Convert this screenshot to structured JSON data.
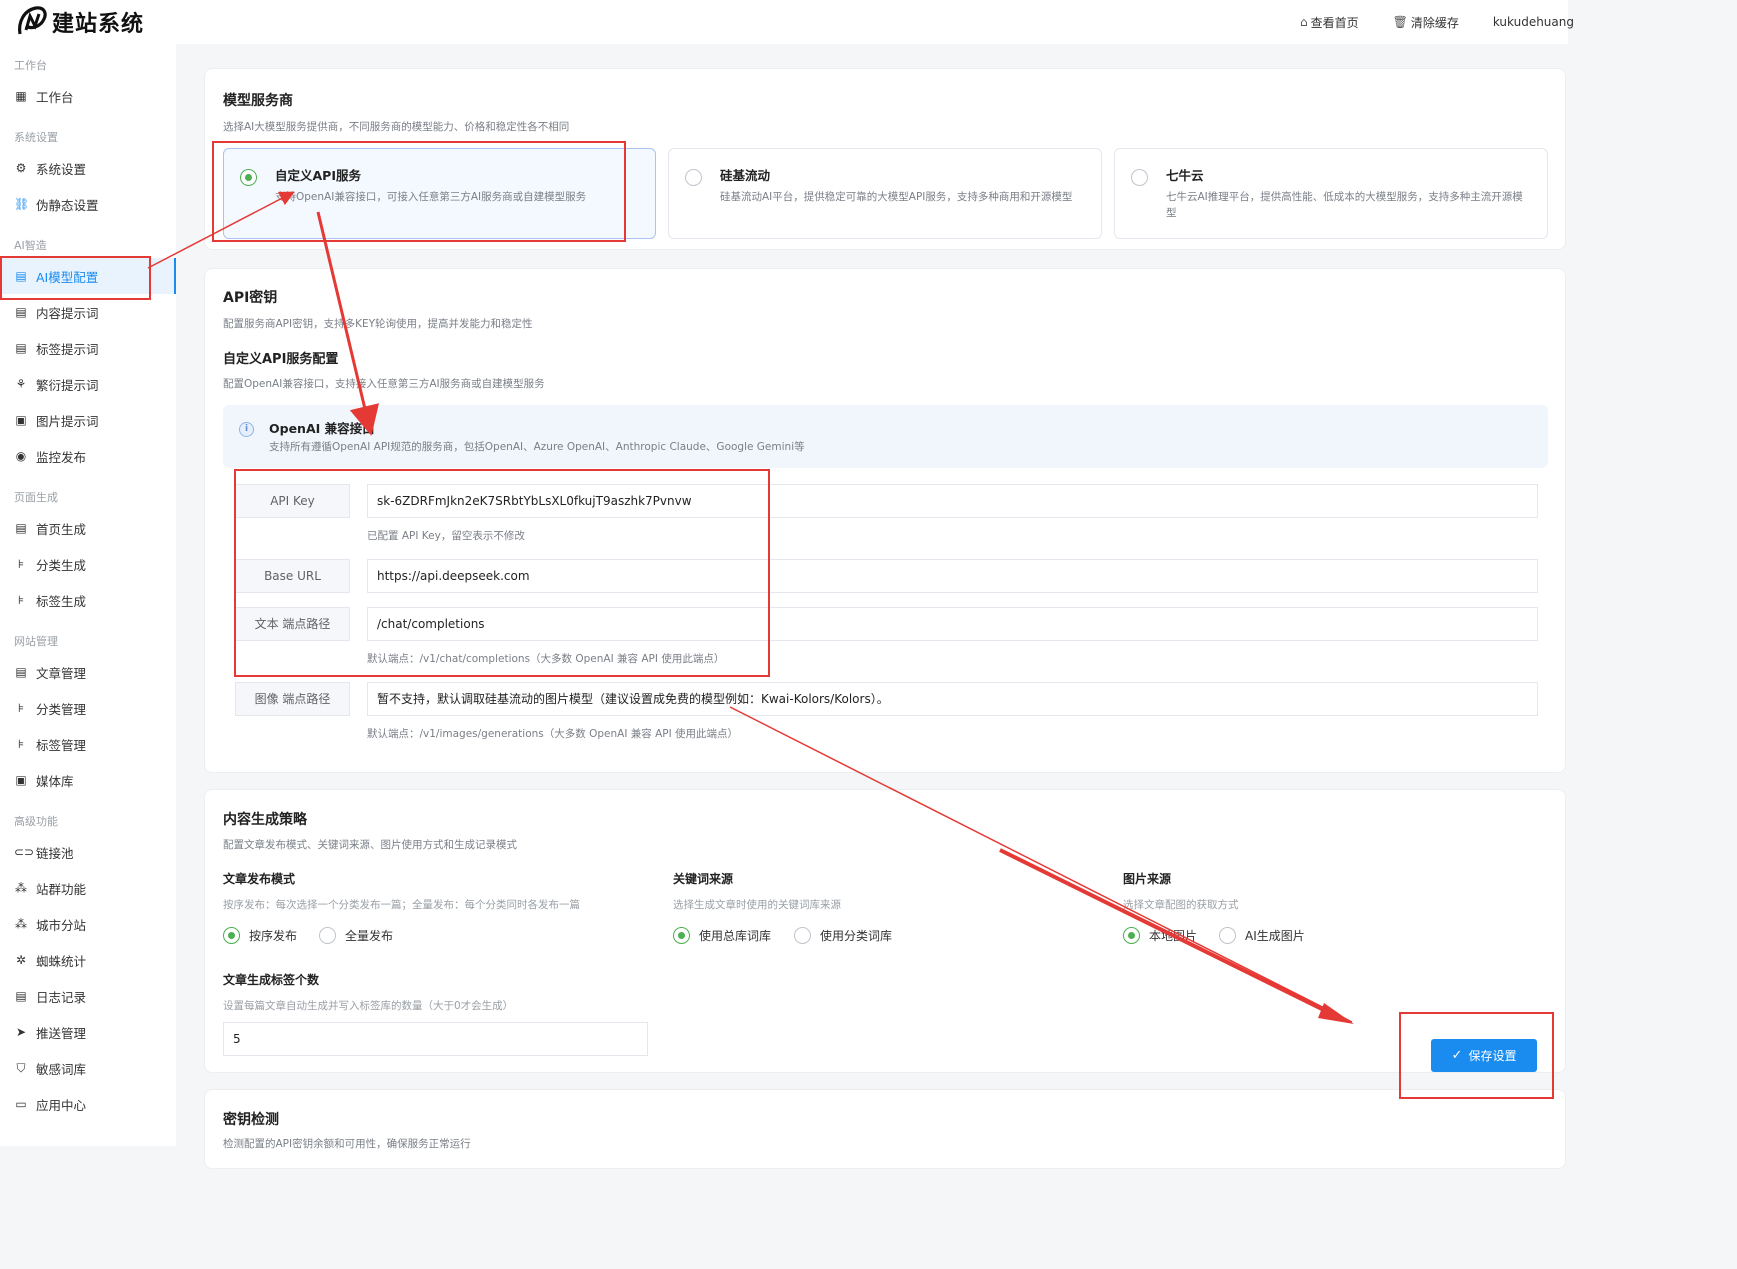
{
  "header": {
    "logo_text": "建站系统",
    "view_home": "查看首页",
    "clear_cache": "清除缓存",
    "username": "kukudehuang"
  },
  "sidebar": {
    "groups": [
      {
        "label": "工作台",
        "items": [
          {
            "label": "工作台",
            "icon": "grid-icon"
          }
        ]
      },
      {
        "label": "系统设置",
        "items": [
          {
            "label": "系统设置",
            "icon": "gear-icon"
          },
          {
            "label": "伪静态设置",
            "icon": "sitemap-icon"
          }
        ]
      },
      {
        "label": "AI智造",
        "items": [
          {
            "label": "AI模型配置",
            "icon": "document-icon",
            "active": true
          },
          {
            "label": "内容提示词",
            "icon": "file-text-icon"
          },
          {
            "label": "标签提示词",
            "icon": "file-text-icon"
          },
          {
            "label": "繁衍提示词",
            "icon": "share-nodes-icon"
          },
          {
            "label": "图片提示词",
            "icon": "image-icon"
          },
          {
            "label": "监控发布",
            "icon": "eye-icon"
          }
        ]
      },
      {
        "label": "页面生成",
        "items": [
          {
            "label": "首页生成",
            "icon": "document-icon"
          },
          {
            "label": "分类生成",
            "icon": "tree-icon"
          },
          {
            "label": "标签生成",
            "icon": "tree-icon"
          }
        ]
      },
      {
        "label": "网站管理",
        "items": [
          {
            "label": "文章管理",
            "icon": "file-text-icon"
          },
          {
            "label": "分类管理",
            "icon": "tree-icon"
          },
          {
            "label": "标签管理",
            "icon": "tree-icon"
          },
          {
            "label": "媒体库",
            "icon": "image-icon"
          }
        ]
      },
      {
        "label": "高级功能",
        "items": [
          {
            "label": "链接池",
            "icon": "link-icon"
          },
          {
            "label": "站群功能",
            "icon": "cluster-icon"
          },
          {
            "label": "城市分站",
            "icon": "cluster-icon"
          },
          {
            "label": "蜘蛛统计",
            "icon": "spider-icon"
          },
          {
            "label": "日志记录",
            "icon": "file-text-icon"
          },
          {
            "label": "推送管理",
            "icon": "send-icon"
          },
          {
            "label": "敏感词库",
            "icon": "shield-icon"
          },
          {
            "label": "应用中心",
            "icon": "window-icon"
          }
        ]
      }
    ]
  },
  "provider_card": {
    "title": "模型服务商",
    "desc": "选择AI大模型服务提供商，不同服务商的模型能力、价格和稳定性各不相同",
    "providers": [
      {
        "name": "自定义API服务",
        "desc": "支持OpenAI兼容接口，可接入任意第三方AI服务商或自建模型服务",
        "selected": true
      },
      {
        "name": "硅基流动",
        "desc": "硅基流动AI平台，提供稳定可靠的大模型API服务，支持多种商用和开源模型",
        "selected": false
      },
      {
        "name": "七牛云",
        "desc": "七牛云AI推理平台，提供高性能、低成本的大模型服务，支持多种主流开源模型",
        "selected": false
      }
    ]
  },
  "api_card": {
    "title": "API密钥",
    "desc": "配置服务商API密钥，支持多KEY轮询使用，提高并发能力和稳定性",
    "sub_title": "自定义API服务配置",
    "sub_desc": "配置OpenAI兼容接口，支持接入任意第三方AI服务商或自建模型服务",
    "notice_title": "OpenAI 兼容接口",
    "notice_desc": "支持所有遵循OpenAI API规范的服务商，包括OpenAI、Azure OpenAI、Anthropic Claude、Google Gemini等",
    "fields": {
      "api_key_label": "API Key",
      "api_key_value": "sk-6ZDRFmJkn2eK7SRbtYbLsXL0fkujT9aszhk7Pvnvw",
      "api_key_hint": "已配置 API Key，留空表示不修改",
      "base_url_label": "Base URL",
      "base_url_value": "https://api.deepseek.com",
      "text_path_label": "文本 端点路径",
      "text_path_value": "/chat/completions",
      "text_path_hint": "默认端点：/v1/chat/completions（大多数 OpenAI 兼容 API 使用此端点）",
      "image_path_label": "图像 端点路径",
      "image_path_value": "暂不支持，默认调取硅基流动的图片模型（建议设置成免费的模型例如：Kwai-Kolors/Kolors）。",
      "image_path_hint": "默认端点：/v1/images/generations（大多数 OpenAI 兼容 API 使用此端点）"
    }
  },
  "strategy_card": {
    "title": "内容生成策略",
    "desc": "配置文章发布模式、关键词来源、图片使用方式和生成记录模式",
    "publish_mode": {
      "title": "文章发布模式",
      "desc": "按序发布：每次选择一个分类发布一篇；全量发布：每个分类同时各发布一篇",
      "options": [
        "按序发布",
        "全量发布"
      ],
      "selected": 0
    },
    "keyword_source": {
      "title": "关键词来源",
      "desc": "选择生成文章时使用的关键词库来源",
      "options": [
        "使用总库词库",
        "使用分类词库"
      ],
      "selected": 0
    },
    "image_source": {
      "title": "图片来源",
      "desc": "选择文章配图的获取方式",
      "options": [
        "本地图片",
        "AI生成图片"
      ],
      "selected": 0
    },
    "tag_count": {
      "title": "文章生成标签个数",
      "desc": "设置每篇文章自动生成并写入标签库的数量（大于0才会生成）",
      "value": "5"
    },
    "save_label": "保存设置"
  },
  "key_check_card": {
    "title": "密钥检测",
    "desc": "检测配置的API密钥余额和可用性，确保服务正常运行"
  },
  "colors": {
    "accent": "#1a8cf0",
    "radio_on": "#4caf50",
    "annotation": "#e53935"
  }
}
